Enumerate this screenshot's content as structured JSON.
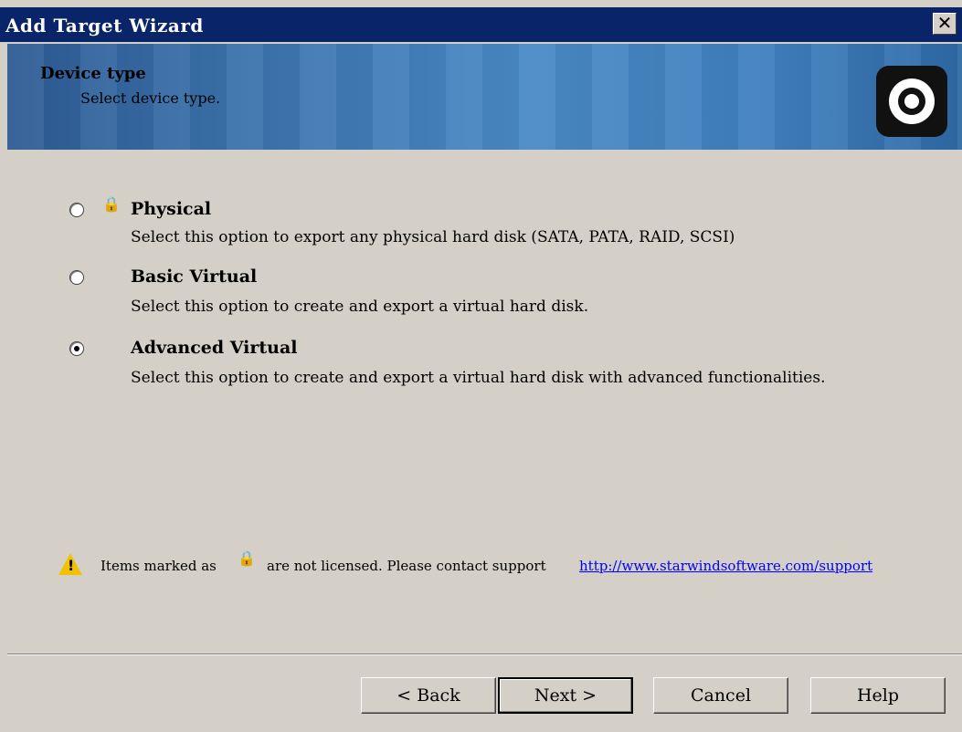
{
  "window": {
    "title": "Add Target Wizard",
    "close_label": "✕"
  },
  "header": {
    "title": "Device type",
    "subtitle": "Select device type."
  },
  "options": [
    {
      "title": "Physical",
      "description": "Select this option to export any physical hard disk (SATA, PATA, RAID, SCSI)",
      "selected": false,
      "locked": true
    },
    {
      "title": "Basic Virtual",
      "description": "Select this option to create and export a virtual hard disk.",
      "selected": false,
      "locked": false
    },
    {
      "title": "Advanced Virtual",
      "description": "Select this option to create and export a virtual hard disk with advanced functionalities.",
      "selected": true,
      "locked": false
    }
  ],
  "notice": {
    "text_before": "Items marked as",
    "text_after": "are not licensed. Please contact support",
    "link": "http://www.starwindsoftware.com/support"
  },
  "buttons": {
    "back": "< Back",
    "next": "Next >",
    "cancel": "Cancel",
    "help": "Help"
  },
  "icons": {
    "warning": "warning-icon",
    "lock": "lock-icon",
    "logo": "starwind-logo-icon"
  },
  "colors": {
    "titlebar": "#0a246a",
    "dialog_bg": "#d4d0c8",
    "link": "#0000ff",
    "warning": "#f2c200"
  }
}
